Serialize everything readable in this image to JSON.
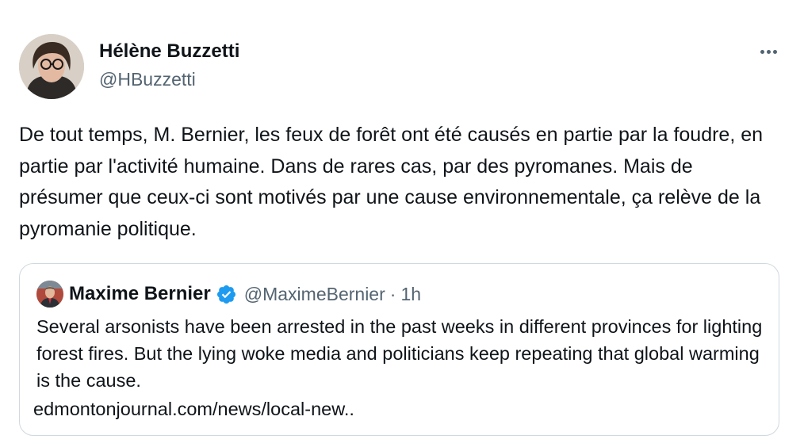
{
  "tweet": {
    "author": {
      "name": "Hélène Buzzetti",
      "handle": "@HBuzzetti"
    },
    "more_icon": "more-horizontal-icon",
    "text": "De tout temps, M. Bernier, les feux de forêt ont été causés en partie par la foudre, en partie par l'activité humaine. Dans de rares cas, par des pyromanes. Mais de présumer que ceux-ci sont motivés par une cause environnementale, ça relève de la pyromanie politique."
  },
  "quoted_tweet": {
    "author": {
      "name": "Maxime Bernier",
      "handle": "@MaximeBernier",
      "verified_icon": "verified-badge-icon"
    },
    "separator": "·",
    "time": "1h",
    "text": "Several arsonists have been arrested in the past weeks in different provinces for lighting forest fires. But the lying woke media and politicians keep repeating that global warming is the cause.",
    "link": "edmontonjournal.com/news/local-new.."
  },
  "colors": {
    "text": "#0f1419",
    "secondary": "#536471",
    "border": "#cfd9de",
    "verified": "#1d9bf0"
  }
}
